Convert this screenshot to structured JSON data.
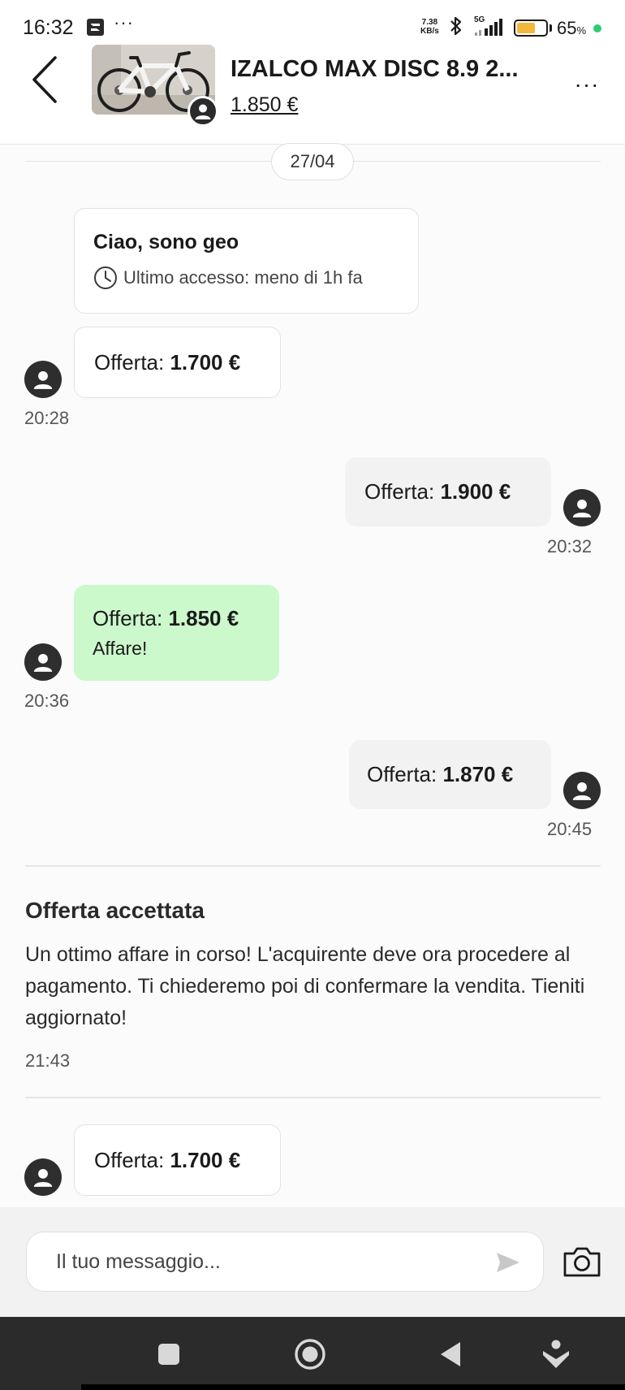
{
  "status_bar": {
    "time": "16:32",
    "more_indicator": "···",
    "net_speed_value": "7.38",
    "net_speed_unit": "KB/s",
    "signal_label": "5G",
    "battery_percent": "65",
    "battery_level": 0.65,
    "battery_unit": "%",
    "battery_color": "#f2b83c",
    "dot_color": "#2ecc71",
    "icons": [
      "notification-app-icon",
      "bluetooth-icon",
      "signal-icon",
      "battery-icon"
    ]
  },
  "header": {
    "back_icon": "chevron-left-icon",
    "product_title": "IZALCO MAX DISC 8.9 2...",
    "product_price": "1.850 €",
    "more_icon": "more-horizontal-icon",
    "more_label": "···"
  },
  "chat": {
    "date": "27/04",
    "intro": {
      "title": "Ciao, sono geo",
      "last_access": "Ultimo accesso: meno di 1h fa"
    },
    "messages": [
      {
        "side": "in",
        "label": "Offerta: ",
        "amount": "1.700 €",
        "time": "20:28"
      },
      {
        "side": "out",
        "label": "Offerta: ",
        "amount": "1.900 €",
        "time": "20:32"
      },
      {
        "side": "in",
        "label": "Offerta: ",
        "amount": "1.850 €",
        "note": "Affare!",
        "time": "20:36",
        "color": "#ccf9cc"
      },
      {
        "side": "out",
        "label": "Offerta: ",
        "amount": "1.870 €",
        "time": "20:45"
      },
      {
        "side": "in",
        "label": "Offerta: ",
        "amount": "1.700 €"
      }
    ],
    "accepted": {
      "title": "Offerta accettata",
      "body": "Un ottimo affare in corso! L'acquirente deve ora procedere al pagamento. Ti chiederemo poi di confermare la vendita. Tieniti aggiornato!",
      "time": "21:43"
    }
  },
  "composer": {
    "placeholder": "Il tuo messaggio...",
    "send_icon": "send-icon",
    "camera_icon": "camera-icon"
  },
  "nav_bar": {
    "buttons": [
      "recents-icon",
      "home-icon",
      "back-icon",
      "assistant-icon"
    ]
  }
}
